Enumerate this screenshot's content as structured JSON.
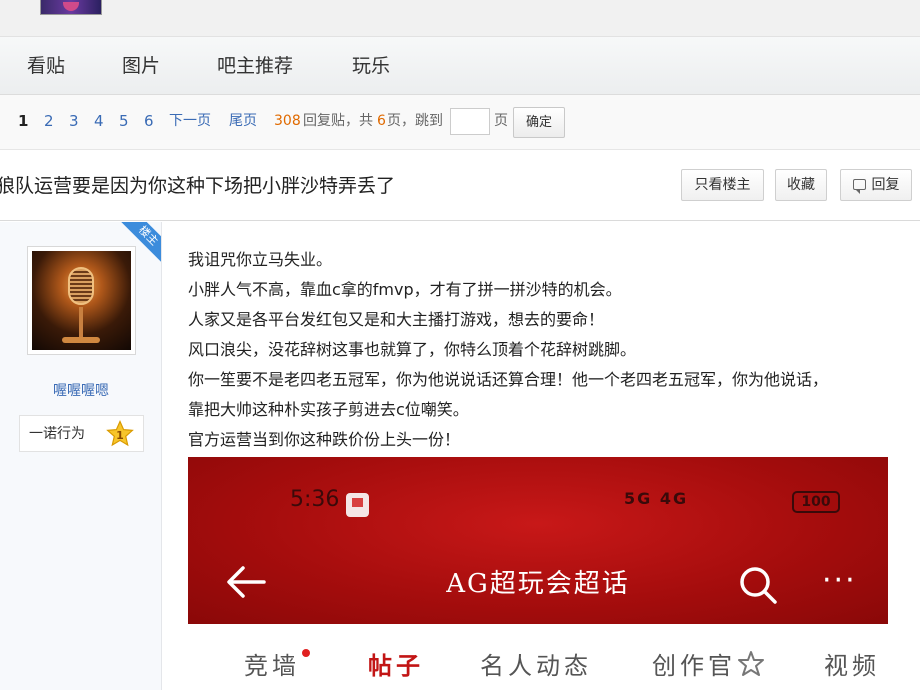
{
  "nav": {
    "items": [
      "看贴",
      "图片",
      "吧主推荐",
      "玩乐"
    ]
  },
  "pager": {
    "pages": [
      "1",
      "2",
      "3",
      "4",
      "5",
      "6"
    ],
    "current": "1",
    "next_label": "下一页",
    "last_label": "尾页",
    "reply_count": "308",
    "reply_suffix": "回复贴，共",
    "total_pages": "6",
    "pages_suffix": "页，跳到",
    "page_unit": "页",
    "jump_value": "",
    "confirm_label": "确定"
  },
  "post": {
    "title": "狼队运营要是因为你这种下场把小胖沙特弄丢了",
    "only_op_label": "只看楼主",
    "favorite_label": "收藏",
    "reply_label": "回复"
  },
  "author": {
    "ribbon": "楼主",
    "username": "喔喔喔嗯",
    "badge_name": "一诺行为",
    "badge_level": "1",
    "colors": {
      "link": "#3a6bb5",
      "ribbon": "#3c8cdc",
      "star": "#f5b800"
    }
  },
  "content": {
    "lines": [
      "我诅咒你立马失业。",
      "小胖人气不高，靠血c拿的fmvp，才有了拼一拼沙特的机会。",
      "人家又是各平台发红包又是和大主播打游戏，想去的要命！",
      "风口浪尖，没花辞树这事也就算了，你特么顶着个花辞树跳脚。",
      "你一笙要不是老四老五冠军，你为他说说话还算合理！他一个老四老五冠军，你为他说话，",
      "靠把大帅这种朴实孩子剪进去c位嘲笑。",
      "官方运营当到你这种跌价份上头一份！"
    ]
  },
  "embedded_screenshot": {
    "time": "5:36",
    "status_text": "5G 4G",
    "battery": "100",
    "title": "AG超玩会超话",
    "more": "···",
    "tabs": [
      "竞墙",
      "帖子",
      "名人动态",
      "创作官",
      "视频"
    ],
    "active_tab": "帖子",
    "colors": {
      "header": "#b31010",
      "active_tab": "#c21515"
    }
  }
}
